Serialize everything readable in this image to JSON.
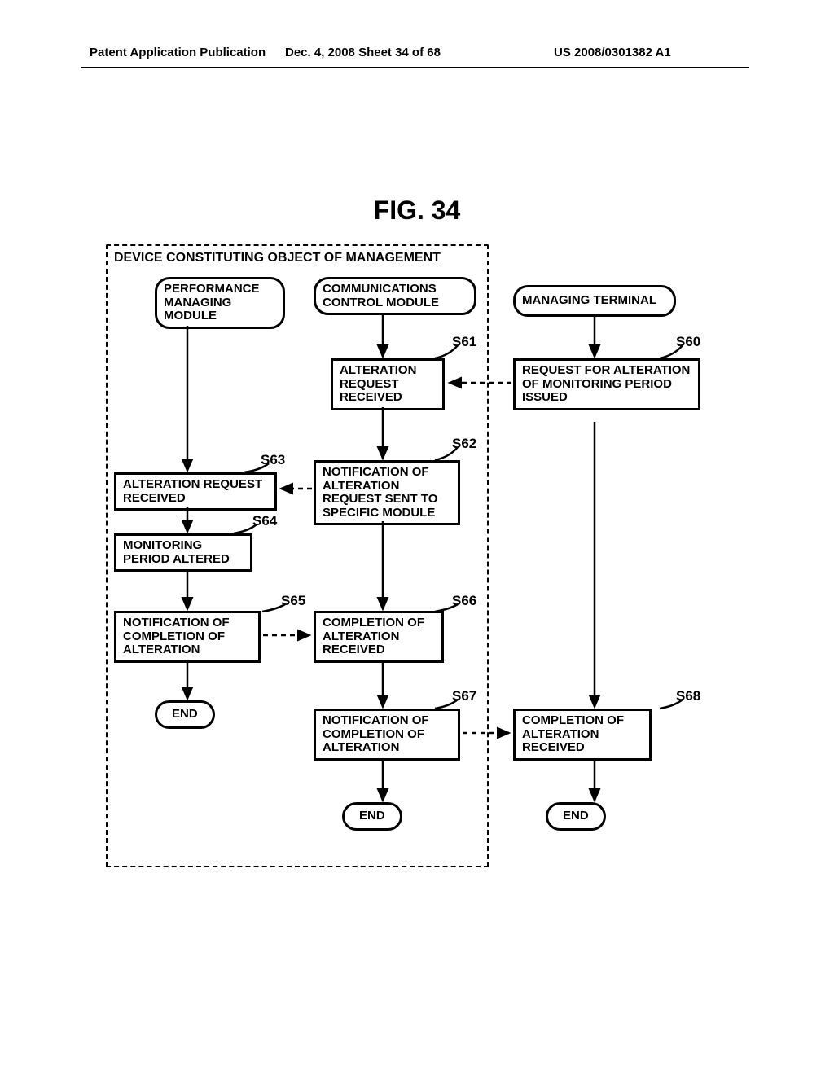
{
  "header": {
    "left": "Patent Application Publication",
    "center": "Dec. 4, 2008  Sheet 34 of 68",
    "right": "US 2008/0301382 A1"
  },
  "figure_title": "FIG. 34",
  "device_label": "DEVICE CONSTITUTING OBJECT OF MANAGEMENT",
  "lanes": {
    "lane1_title": "PERFORMANCE MANAGING MODULE",
    "lane2_title": "COMMUNICATIONS CONTROL MODULE",
    "lane3_title": "MANAGING TERMINAL"
  },
  "steps": {
    "s60": {
      "tag": "S60",
      "text": "REQUEST FOR ALTERATION OF MONITORING PERIOD ISSUED"
    },
    "s61": {
      "tag": "S61",
      "text": "ALTERATION REQUEST RECEIVED"
    },
    "s62": {
      "tag": "S62",
      "text": "NOTIFICATION OF ALTERATION REQUEST SENT TO SPECIFIC MODULE"
    },
    "s63": {
      "tag": "S63",
      "text": "ALTERATION REQUEST RECEIVED"
    },
    "s64": {
      "tag": "S64",
      "text": "MONITORING PERIOD ALTERED"
    },
    "s65": {
      "tag": "S65",
      "text": "NOTIFICATION OF COMPLETION OF ALTERATION"
    },
    "s66": {
      "tag": "S66",
      "text": "COMPLETION OF ALTERATION RECEIVED"
    },
    "s67": {
      "tag": "S67",
      "text": "NOTIFICATION OF COMPLETION OF ALTERATION"
    },
    "s68": {
      "tag": "S68",
      "text": "COMPLETION OF ALTERATION RECEIVED"
    }
  },
  "terminators": {
    "end1": "END",
    "end2": "END",
    "end3": "END"
  }
}
